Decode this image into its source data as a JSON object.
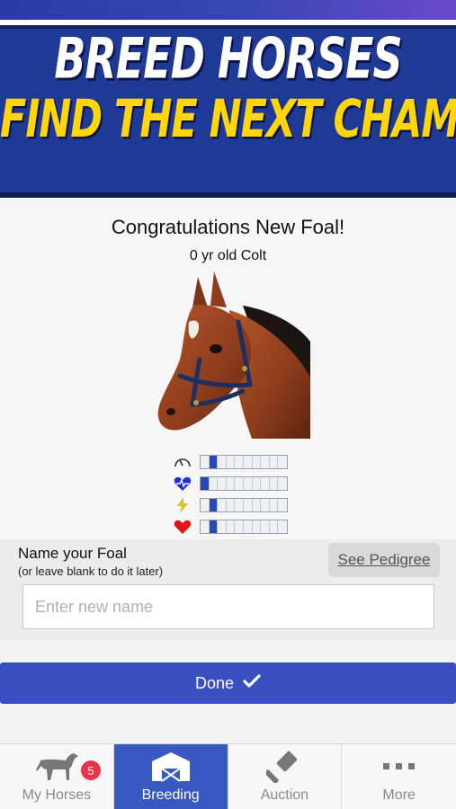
{
  "banner": {
    "line1": "BREED HORSES",
    "line2": "FIND THE NEXT CHAMP!"
  },
  "foal": {
    "title": "Congratulations New Foal!",
    "subtitle": "0 yr old Colt",
    "stats": [
      {
        "icon": "speed-gauge-icon",
        "color": "#333333",
        "level": 0.2,
        "name": "speed"
      },
      {
        "icon": "heartbeat-icon",
        "color": "#1f2fd0",
        "level": 0.1,
        "name": "stamina"
      },
      {
        "icon": "lightning-icon",
        "color": "#d6c21a",
        "level": 0.2,
        "name": "acceleration"
      },
      {
        "icon": "heart-icon",
        "color": "#e01616",
        "level": 0.2,
        "name": "health"
      }
    ]
  },
  "naming": {
    "label": "Name your Foal",
    "hint": "(or leave blank to do it later)",
    "pedigree_button": "See Pedigree",
    "input_value": "",
    "input_placeholder": "Enter new name"
  },
  "done_button": {
    "label": "Done",
    "icon": "checkmark-icon"
  },
  "nav": {
    "items": [
      {
        "label": "My Horses",
        "icon": "horse-icon",
        "badge": "5",
        "active": false
      },
      {
        "label": "Breeding",
        "icon": "barn-icon",
        "active": true
      },
      {
        "label": "Auction",
        "icon": "gavel-icon",
        "active": false
      },
      {
        "label": "More",
        "icon": "more-dots-icon",
        "active": false
      }
    ]
  },
  "colors": {
    "banner_bg": "#1e3a96",
    "banner_yellow": "#ffd60a",
    "accent_blue": "#3a4fc0",
    "nav_active": "#3a58c2",
    "badge_red": "#e8334a"
  }
}
